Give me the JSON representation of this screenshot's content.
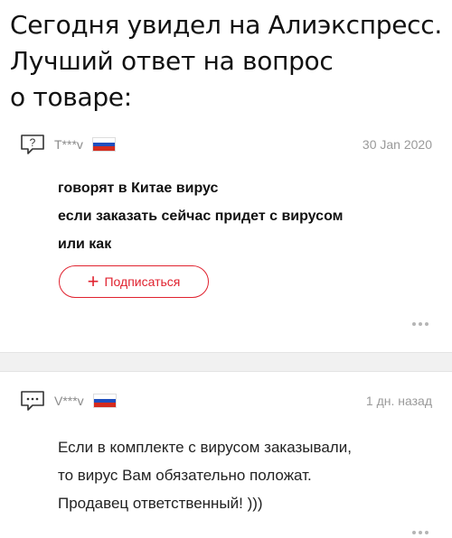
{
  "headline": {
    "lines": [
      "Сегодня увидел на Алиэкспресс.",
      "Лучший ответ на вопрос",
      "о товаре:"
    ]
  },
  "question": {
    "type_icon": "question-bubble-icon",
    "user": "T***v",
    "country_flag": "russia-flag-icon",
    "date": "30 Jan 2020",
    "lines": [
      "говорят в Китае вирус",
      "если заказать сейчас придет с вирусом",
      "или как"
    ],
    "follow_button": {
      "icon": "plus-icon",
      "label": "Подписаться",
      "color": "#e0222f"
    },
    "more_icon": "more-dots-icon"
  },
  "answer": {
    "type_icon": "answer-bubble-icon",
    "user": "V***v",
    "country_flag": "russia-flag-icon",
    "date": "1 дн. назад",
    "lines": [
      "Если в комплекте с вирусом заказывали,",
      "то вирус Вам обязательно положат.",
      "Продавец ответственный!  )))"
    ],
    "more_icon": "more-dots-icon"
  }
}
